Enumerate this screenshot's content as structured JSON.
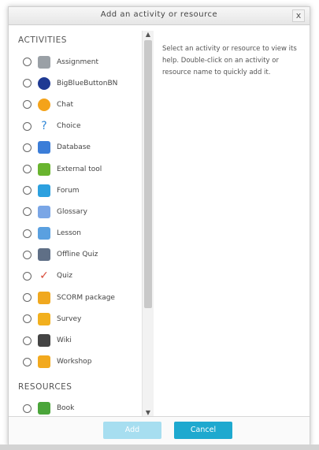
{
  "dialog": {
    "title": "Add an activity or resource",
    "close_label": "x"
  },
  "activities_header": "ACTIVITIES",
  "resources_header": "RESOURCES",
  "activities": [
    {
      "label": "Assignment",
      "icon": "assignment-icon",
      "color": "#9aa0a6"
    },
    {
      "label": "BigBlueButtonBN",
      "icon": "bigbluebutton-icon",
      "color": "#1f3a93"
    },
    {
      "label": "Chat",
      "icon": "chat-icon",
      "color": "#f4a31a"
    },
    {
      "label": "Choice",
      "icon": "question-mark-icon",
      "color": "#2f86d6"
    },
    {
      "label": "Database",
      "icon": "database-icon",
      "color": "#3b7dd8"
    },
    {
      "label": "External tool",
      "icon": "puzzle-icon",
      "color": "#69b42f"
    },
    {
      "label": "Forum",
      "icon": "forum-icon",
      "color": "#2ca0df"
    },
    {
      "label": "Glossary",
      "icon": "glossary-icon",
      "color": "#7aa6e6"
    },
    {
      "label": "Lesson",
      "icon": "lesson-icon",
      "color": "#5aa0e0"
    },
    {
      "label": "Offline Quiz",
      "icon": "offline-quiz-icon",
      "color": "#5f6f86"
    },
    {
      "label": "Quiz",
      "icon": "quiz-check-icon",
      "color": "#d84b3a"
    },
    {
      "label": "SCORM package",
      "icon": "scorm-icon",
      "color": "#f0a81f"
    },
    {
      "label": "Survey",
      "icon": "survey-icon",
      "color": "#f2b01e"
    },
    {
      "label": "Wiki",
      "icon": "wiki-icon",
      "color": "#444444"
    },
    {
      "label": "Workshop",
      "icon": "workshop-icon",
      "color": "#f2a91e"
    }
  ],
  "resources": [
    {
      "label": "Book",
      "icon": "book-icon",
      "color": "#4aa53a"
    }
  ],
  "help_text": "Select an activity or resource to view its help. Double-click on an activity or resource name to quickly add it.",
  "buttons": {
    "add": "Add",
    "cancel": "Cancel"
  }
}
